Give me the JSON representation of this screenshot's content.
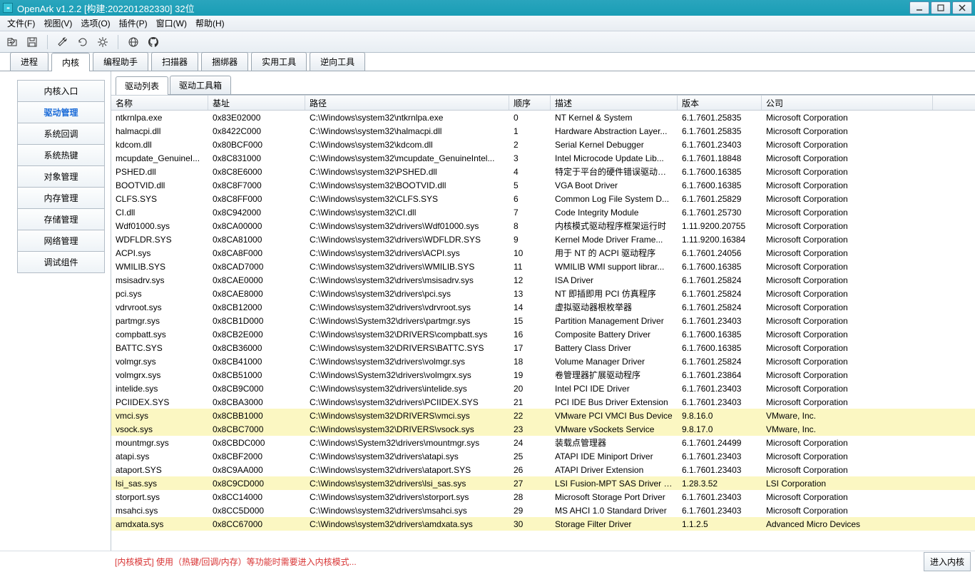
{
  "title": "OpenArk v1.2.2  [构建:202201282330]  32位",
  "menus": [
    "文件(F)",
    "视图(V)",
    "选项(O)",
    "插件(P)",
    "窗口(W)",
    "帮助(H)"
  ],
  "tabs": [
    "进程",
    "内核",
    "编程助手",
    "扫描器",
    "捆绑器",
    "实用工具",
    "逆向工具"
  ],
  "tabs_active": 1,
  "side": [
    "内核入口",
    "驱动管理",
    "系统回调",
    "系统热键",
    "对象管理",
    "内存管理",
    "存储管理",
    "网络管理",
    "调试组件"
  ],
  "side_active": 1,
  "subtabs": [
    "驱动列表",
    "驱动工具箱"
  ],
  "subtabs_active": 0,
  "columns": [
    "名称",
    "基址",
    "路径",
    "顺序",
    "描述",
    "版本",
    "公司"
  ],
  "status_msg": "[内核模式] 使用（热键/回调/内存）等功能时需要进入内核模式...",
  "status_btn": "进入内核",
  "rows": [
    {
      "hl": false,
      "c": [
        "ntkrnlpa.exe",
        "0x83E02000",
        "C:\\Windows\\system32\\ntkrnlpa.exe",
        "0",
        "NT Kernel & System",
        "6.1.7601.25835",
        "Microsoft Corporation"
      ]
    },
    {
      "hl": false,
      "c": [
        "halmacpi.dll",
        "0x8422C000",
        "C:\\Windows\\system32\\halmacpi.dll",
        "1",
        "Hardware Abstraction Layer...",
        "6.1.7601.25835",
        "Microsoft Corporation"
      ]
    },
    {
      "hl": false,
      "c": [
        "kdcom.dll",
        "0x80BCF000",
        "C:\\Windows\\system32\\kdcom.dll",
        "2",
        "Serial Kernel Debugger",
        "6.1.7601.23403",
        "Microsoft Corporation"
      ]
    },
    {
      "hl": false,
      "c": [
        "mcupdate_GenuineI...",
        "0x8C831000",
        "C:\\Windows\\system32\\mcupdate_GenuineIntel...",
        "3",
        "Intel Microcode Update Lib...",
        "6.1.7601.18848",
        "Microsoft Corporation"
      ]
    },
    {
      "hl": false,
      "c": [
        "PSHED.dll",
        "0x8C8E6000",
        "C:\\Windows\\system32\\PSHED.dll",
        "4",
        "特定于平台的硬件错误驱动程序",
        "6.1.7600.16385",
        "Microsoft Corporation"
      ]
    },
    {
      "hl": false,
      "c": [
        "BOOTVID.dll",
        "0x8C8F7000",
        "C:\\Windows\\system32\\BOOTVID.dll",
        "5",
        "VGA Boot Driver",
        "6.1.7600.16385",
        "Microsoft Corporation"
      ]
    },
    {
      "hl": false,
      "c": [
        "CLFS.SYS",
        "0x8C8FF000",
        "C:\\Windows\\system32\\CLFS.SYS",
        "6",
        "Common Log File System D...",
        "6.1.7601.25829",
        "Microsoft Corporation"
      ]
    },
    {
      "hl": false,
      "c": [
        "CI.dll",
        "0x8C942000",
        "C:\\Windows\\system32\\CI.dll",
        "7",
        "Code Integrity Module",
        "6.1.7601.25730",
        "Microsoft Corporation"
      ]
    },
    {
      "hl": false,
      "c": [
        "Wdf01000.sys",
        "0x8CA00000",
        "C:\\Windows\\system32\\drivers\\Wdf01000.sys",
        "8",
        "内核模式驱动程序框架运行时",
        "1.11.9200.20755",
        "Microsoft Corporation"
      ]
    },
    {
      "hl": false,
      "c": [
        "WDFLDR.SYS",
        "0x8CA81000",
        "C:\\Windows\\system32\\drivers\\WDFLDR.SYS",
        "9",
        "Kernel Mode Driver Frame...",
        "1.11.9200.16384",
        "Microsoft Corporation"
      ]
    },
    {
      "hl": false,
      "c": [
        "ACPI.sys",
        "0x8CA8F000",
        "C:\\Windows\\system32\\drivers\\ACPI.sys",
        "10",
        "用于 NT 的 ACPI 驱动程序",
        "6.1.7601.24056",
        "Microsoft Corporation"
      ]
    },
    {
      "hl": false,
      "c": [
        "WMILIB.SYS",
        "0x8CAD7000",
        "C:\\Windows\\system32\\drivers\\WMILIB.SYS",
        "11",
        "WMILIB WMI support librar...",
        "6.1.7600.16385",
        "Microsoft Corporation"
      ]
    },
    {
      "hl": false,
      "c": [
        "msisadrv.sys",
        "0x8CAE0000",
        "C:\\Windows\\system32\\drivers\\msisadrv.sys",
        "12",
        "ISA Driver",
        "6.1.7601.25824",
        "Microsoft Corporation"
      ]
    },
    {
      "hl": false,
      "c": [
        "pci.sys",
        "0x8CAE8000",
        "C:\\Windows\\system32\\drivers\\pci.sys",
        "13",
        "NT 即插即用 PCI 仿真程序",
        "6.1.7601.25824",
        "Microsoft Corporation"
      ]
    },
    {
      "hl": false,
      "c": [
        "vdrvroot.sys",
        "0x8CB12000",
        "C:\\Windows\\system32\\drivers\\vdrvroot.sys",
        "14",
        "虚拟驱动器根枚举器",
        "6.1.7601.25824",
        "Microsoft Corporation"
      ]
    },
    {
      "hl": false,
      "c": [
        "partmgr.sys",
        "0x8CB1D000",
        "C:\\Windows\\System32\\drivers\\partmgr.sys",
        "15",
        "Partition Management Driver",
        "6.1.7601.23403",
        "Microsoft Corporation"
      ]
    },
    {
      "hl": false,
      "c": [
        "compbatt.sys",
        "0x8CB2E000",
        "C:\\Windows\\system32\\DRIVERS\\compbatt.sys",
        "16",
        "Composite Battery Driver",
        "6.1.7600.16385",
        "Microsoft Corporation"
      ]
    },
    {
      "hl": false,
      "c": [
        "BATTC.SYS",
        "0x8CB36000",
        "C:\\Windows\\system32\\DRIVERS\\BATTC.SYS",
        "17",
        "Battery Class Driver",
        "6.1.7600.16385",
        "Microsoft Corporation"
      ]
    },
    {
      "hl": false,
      "c": [
        "volmgr.sys",
        "0x8CB41000",
        "C:\\Windows\\system32\\drivers\\volmgr.sys",
        "18",
        "Volume Manager Driver",
        "6.1.7601.25824",
        "Microsoft Corporation"
      ]
    },
    {
      "hl": false,
      "c": [
        "volmgrx.sys",
        "0x8CB51000",
        "C:\\Windows\\System32\\drivers\\volmgrx.sys",
        "19",
        "卷管理器扩展驱动程序",
        "6.1.7601.23864",
        "Microsoft Corporation"
      ]
    },
    {
      "hl": false,
      "c": [
        "intelide.sys",
        "0x8CB9C000",
        "C:\\Windows\\system32\\drivers\\intelide.sys",
        "20",
        "Intel PCI IDE Driver",
        "6.1.7601.23403",
        "Microsoft Corporation"
      ]
    },
    {
      "hl": false,
      "c": [
        "PCIIDEX.SYS",
        "0x8CBA3000",
        "C:\\Windows\\system32\\drivers\\PCIIDEX.SYS",
        "21",
        "PCI IDE Bus Driver Extension",
        "6.1.7601.23403",
        "Microsoft Corporation"
      ]
    },
    {
      "hl": true,
      "c": [
        "vmci.sys",
        "0x8CBB1000",
        "C:\\Windows\\system32\\DRIVERS\\vmci.sys",
        "22",
        "VMware PCI VMCI Bus Device",
        "9.8.16.0",
        "VMware, Inc."
      ]
    },
    {
      "hl": true,
      "c": [
        "vsock.sys",
        "0x8CBC7000",
        "C:\\Windows\\system32\\DRIVERS\\vsock.sys",
        "23",
        "VMware vSockets Service",
        "9.8.17.0",
        "VMware, Inc."
      ]
    },
    {
      "hl": false,
      "c": [
        "mountmgr.sys",
        "0x8CBDC000",
        "C:\\Windows\\System32\\drivers\\mountmgr.sys",
        "24",
        "装载点管理器",
        "6.1.7601.24499",
        "Microsoft Corporation"
      ]
    },
    {
      "hl": false,
      "c": [
        "atapi.sys",
        "0x8CBF2000",
        "C:\\Windows\\system32\\drivers\\atapi.sys",
        "25",
        "ATAPI IDE Miniport Driver",
        "6.1.7601.23403",
        "Microsoft Corporation"
      ]
    },
    {
      "hl": false,
      "c": [
        "ataport.SYS",
        "0x8C9AA000",
        "C:\\Windows\\system32\\drivers\\ataport.SYS",
        "26",
        "ATAPI Driver Extension",
        "6.1.7601.23403",
        "Microsoft Corporation"
      ]
    },
    {
      "hl": true,
      "c": [
        "lsi_sas.sys",
        "0x8C9CD000",
        "C:\\Windows\\system32\\drivers\\lsi_sas.sys",
        "27",
        "LSI Fusion-MPT SAS Driver (...",
        "1.28.3.52",
        "LSI Corporation"
      ]
    },
    {
      "hl": false,
      "c": [
        "storport.sys",
        "0x8CC14000",
        "C:\\Windows\\system32\\drivers\\storport.sys",
        "28",
        "Microsoft Storage Port Driver",
        "6.1.7601.23403",
        "Microsoft Corporation"
      ]
    },
    {
      "hl": false,
      "c": [
        "msahci.sys",
        "0x8CC5D000",
        "C:\\Windows\\system32\\drivers\\msahci.sys",
        "29",
        "MS AHCI 1.0 Standard Driver",
        "6.1.7601.23403",
        "Microsoft Corporation"
      ]
    },
    {
      "hl": true,
      "c": [
        "amdxata.sys",
        "0x8CC67000",
        "C:\\Windows\\system32\\drivers\\amdxata.sys",
        "30",
        "Storage Filter Driver",
        "1.1.2.5",
        "Advanced Micro Devices"
      ]
    }
  ]
}
